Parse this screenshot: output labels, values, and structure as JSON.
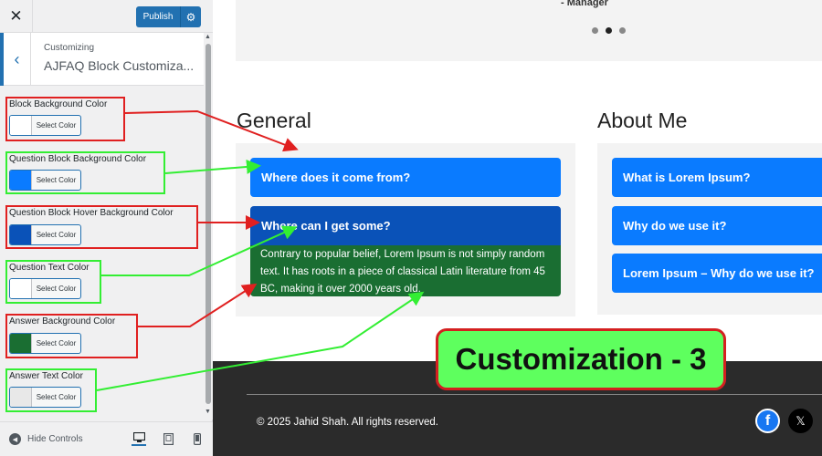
{
  "topbar": {
    "close_glyph": "✕",
    "publish_label": "Publish",
    "gear_glyph": "⚙"
  },
  "section": {
    "back_glyph": "‹",
    "small_label": "Customizing",
    "title": "AJFAQ Block Customiza..."
  },
  "controls": [
    {
      "label": "Block Background Color",
      "button": "Select Color",
      "color": "#ffffff",
      "box": "red"
    },
    {
      "label": "Question Block Background Color",
      "button": "Select Color",
      "color": "#0a7bff",
      "box": "green"
    },
    {
      "label": "Question Block Hover Background Color",
      "button": "Select Color",
      "color": "#0a52b8",
      "box": "red"
    },
    {
      "label": "Question Text Color",
      "button": "Select Color",
      "color": "#ffffff",
      "box": "green"
    },
    {
      "label": "Answer Background Color",
      "button": "Select Color",
      "color": "#1a6e32",
      "box": "red"
    },
    {
      "label": "Answer Text Color",
      "button": "Select Color",
      "color": "#e8e8e8",
      "box": "green"
    }
  ],
  "footer_controls": {
    "hide_label": "Hide Controls",
    "devices": [
      "desktop-icon",
      "tablet-icon",
      "mobile-icon"
    ]
  },
  "preview": {
    "testimonial_author": "- Manager",
    "columns": [
      {
        "title": "General",
        "questions": [
          "Where does it come from?",
          "Where can I get some?"
        ],
        "answer": "Contrary to popular belief, Lorem Ipsum is not simply random text. It has roots in a piece of classical Latin literature from 45 BC, making it over 2000 years old."
      },
      {
        "title": "About Me",
        "questions": [
          "What is Lorem Ipsum?",
          "Why do we use it?",
          "Lorem Ipsum – Why do we use it?"
        ]
      }
    ],
    "copyright": "© 2025 Jahid Shah. All rights reserved.",
    "social": [
      "facebook-icon",
      "x-icon"
    ]
  },
  "badge": "Customization - 3",
  "colors": {
    "accent": "#2271b1",
    "arrow_red": "#e02020",
    "arrow_green": "#33ee33"
  }
}
